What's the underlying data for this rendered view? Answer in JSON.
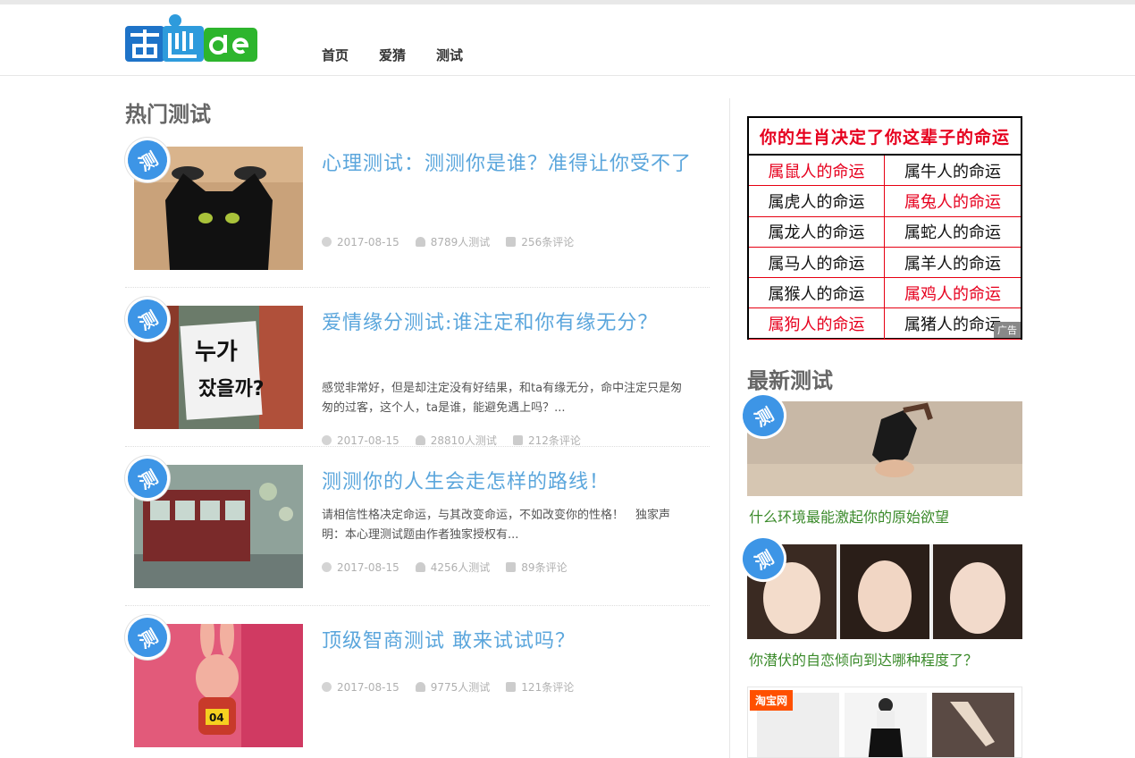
{
  "nav": {
    "items": [
      "首页",
      "爱猜",
      "测试"
    ]
  },
  "main": {
    "section_title": "热门测试",
    "badge_text": "测",
    "posts": [
      {
        "title": "心理测试：测测你是谁？准得让你受不了",
        "excerpt": "",
        "date": "2017-08-15",
        "views": "8789人测试",
        "comments": "256条评论"
      },
      {
        "title": "爱情缘分测试:谁注定和你有缘无分？",
        "excerpt": "感觉非常好，但是却注定没有好结果，和ta有缘无分，命中注定只是匆匆的过客，这个人，ta是谁，能避免遇上吗？...",
        "date": "2017-08-15",
        "views": "28810人测试",
        "comments": "212条评论"
      },
      {
        "title": "测测你的人生会走怎样的路线！",
        "excerpt": "请相信性格决定命运，与其改变命运，不如改变你的性格！　独家声明：本心理测试题由作者独家授权有...",
        "date": "2017-08-15",
        "views": "4256人测试",
        "comments": "89条评论"
      },
      {
        "title": "顶级智商测试 敢来试试吗？",
        "excerpt": "",
        "date": "2017-08-15",
        "views": "9775人测试",
        "comments": "121条评论"
      }
    ]
  },
  "sidebar": {
    "ad": {
      "title": "你的生肖决定了你这辈子的命运",
      "cells": [
        "属鼠人的命运",
        "属牛人的命运",
        "属虎人的命运",
        "属兔人的命运",
        "属龙人的命运",
        "属蛇人的命运",
        "属马人的命运",
        "属羊人的命运",
        "属猴人的命运",
        "属鸡人的命运",
        "属狗人的命运",
        "属猪人的命运"
      ],
      "red_cells": [
        0,
        3,
        9,
        10
      ],
      "ad_label": "广告"
    },
    "latest_title": "最新测试",
    "latest": [
      {
        "caption": "什么环境最能激起你的原始欲望"
      },
      {
        "caption": "你潜伏的自恋倾向到达哪种程度了？"
      }
    ],
    "taobao_label": "淘宝网"
  },
  "colors": {
    "accent_blue": "#3d95e6",
    "title_blue": "#5ba6dc",
    "caption_green": "#3a8a2a",
    "ad_red": "#e6001e"
  }
}
